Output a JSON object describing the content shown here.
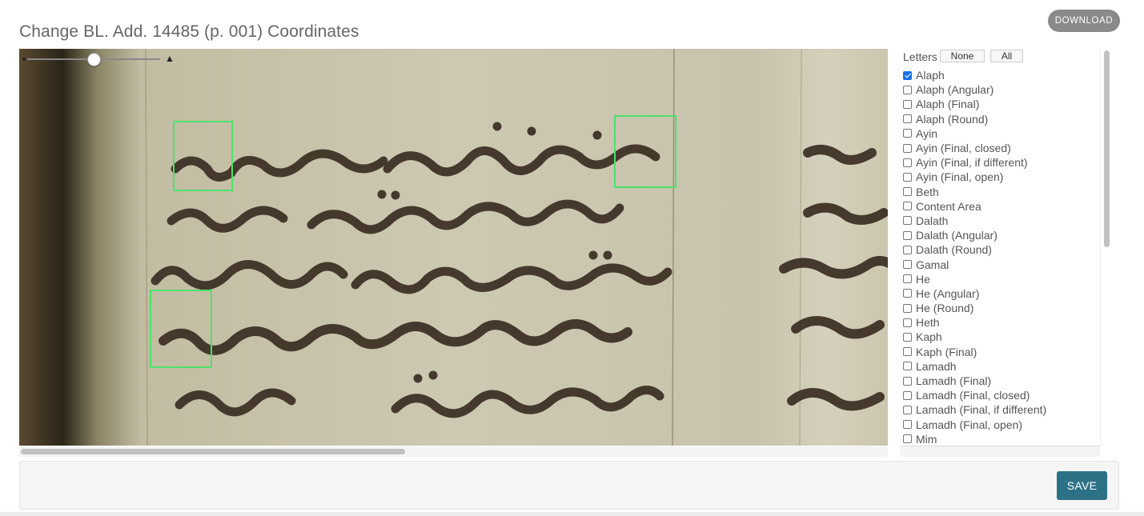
{
  "page": {
    "title": "Change BL. Add. 14485 (p. 001) Coordinates",
    "download_label": "DOWNLOAD"
  },
  "viewer": {
    "zoom_max_symbol": "▲",
    "box_color": "#4be36a",
    "highlighted_letter_count": 3
  },
  "letters": {
    "header": "Letters",
    "none_label": "None",
    "all_label": "All",
    "items": [
      {
        "label": "Alaph",
        "checked": true
      },
      {
        "label": "Alaph (Angular)",
        "checked": false
      },
      {
        "label": "Alaph (Final)",
        "checked": false
      },
      {
        "label": "Alaph (Round)",
        "checked": false
      },
      {
        "label": "Ayin",
        "checked": false
      },
      {
        "label": "Ayin (Final, closed)",
        "checked": false
      },
      {
        "label": "Ayin (Final, if different)",
        "checked": false
      },
      {
        "label": "Ayin (Final, open)",
        "checked": false
      },
      {
        "label": "Beth",
        "checked": false
      },
      {
        "label": "Content Area",
        "checked": false
      },
      {
        "label": "Dalath",
        "checked": false
      },
      {
        "label": "Dalath (Angular)",
        "checked": false
      },
      {
        "label": "Dalath (Round)",
        "checked": false
      },
      {
        "label": "Gamal",
        "checked": false
      },
      {
        "label": "He",
        "checked": false
      },
      {
        "label": "He (Angular)",
        "checked": false
      },
      {
        "label": "He (Round)",
        "checked": false
      },
      {
        "label": "Heth",
        "checked": false
      },
      {
        "label": "Kaph",
        "checked": false
      },
      {
        "label": "Kaph (Final)",
        "checked": false
      },
      {
        "label": "Lamadh",
        "checked": false
      },
      {
        "label": "Lamadh (Final)",
        "checked": false
      },
      {
        "label": "Lamadh (Final, closed)",
        "checked": false
      },
      {
        "label": "Lamadh (Final, if different)",
        "checked": false
      },
      {
        "label": "Lamadh (Final, open)",
        "checked": false
      },
      {
        "label": "Mim",
        "checked": false
      }
    ]
  },
  "footer": {
    "save_label": "SAVE"
  },
  "colors": {
    "save_button": "#2d7187",
    "download_button": "#8a8a8a",
    "checkbox_checked": "#1a73e8",
    "parchment": "#c9c3ab"
  }
}
